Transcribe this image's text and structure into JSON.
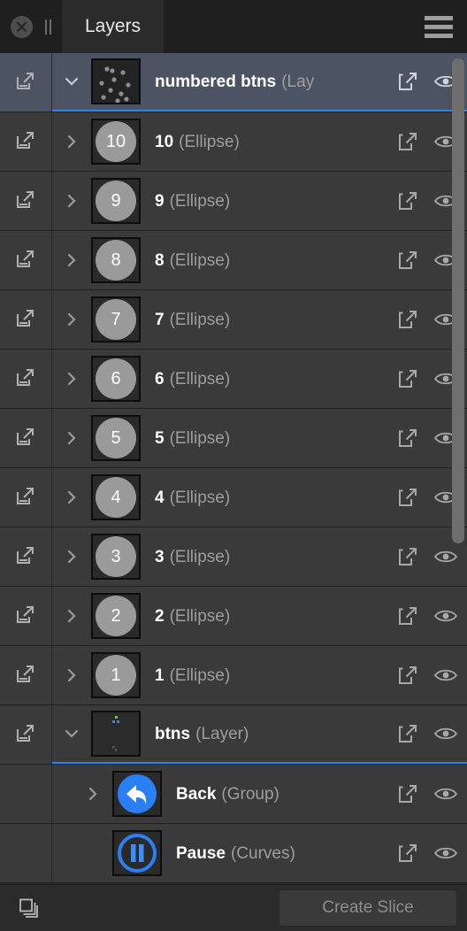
{
  "titlebar": {
    "close_icon": "close-circle-icon",
    "pause_icon": "pause-bars-icon",
    "tab_label": "Layers",
    "menu_icon": "hamburger-menu-icon"
  },
  "colors": {
    "accent_blue": "#2b88f0",
    "selected_row": "#4c5463",
    "row_bg": "#3a3a3a",
    "panel_bg": "#2e2e2e",
    "titlebar_bg": "#1f1f1f",
    "circle_gray": "#9a9a9a",
    "text_primary": "#ffffff",
    "text_secondary": "#9e9e9e"
  },
  "layers": [
    {
      "name": "numbered btns",
      "type": "(Lay",
      "type_full": "(Layer)",
      "thumb": "dots",
      "selected": true,
      "expanded": true,
      "has_export_cell": true,
      "truncated": true,
      "disclosure": "chevron-down-icon",
      "indent": 0
    },
    {
      "name": "10",
      "type": "(Ellipse)",
      "thumb": "number",
      "thumb_value": "10",
      "selected": false,
      "expanded": false,
      "has_export_cell": true,
      "truncated": false,
      "disclosure": "chevron-right-icon",
      "indent": 0
    },
    {
      "name": "9",
      "type": "(Ellipse)",
      "thumb": "number",
      "thumb_value": "9",
      "selected": false,
      "expanded": false,
      "has_export_cell": true,
      "truncated": false,
      "disclosure": "chevron-right-icon",
      "indent": 0
    },
    {
      "name": "8",
      "type": "(Ellipse)",
      "thumb": "number",
      "thumb_value": "8",
      "selected": false,
      "expanded": false,
      "has_export_cell": true,
      "truncated": false,
      "disclosure": "chevron-right-icon",
      "indent": 0
    },
    {
      "name": "7",
      "type": "(Ellipse)",
      "thumb": "number",
      "thumb_value": "7",
      "selected": false,
      "expanded": false,
      "has_export_cell": true,
      "truncated": false,
      "disclosure": "chevron-right-icon",
      "indent": 0
    },
    {
      "name": "6",
      "type": "(Ellipse)",
      "thumb": "number",
      "thumb_value": "6",
      "selected": false,
      "expanded": false,
      "has_export_cell": true,
      "truncated": false,
      "disclosure": "chevron-right-icon",
      "indent": 0
    },
    {
      "name": "5",
      "type": "(Ellipse)",
      "thumb": "number",
      "thumb_value": "5",
      "selected": false,
      "expanded": false,
      "has_export_cell": true,
      "truncated": false,
      "disclosure": "chevron-right-icon",
      "indent": 0
    },
    {
      "name": "4",
      "type": "(Ellipse)",
      "thumb": "number",
      "thumb_value": "4",
      "selected": false,
      "expanded": false,
      "has_export_cell": true,
      "truncated": false,
      "disclosure": "chevron-right-icon",
      "indent": 0
    },
    {
      "name": "3",
      "type": "(Ellipse)",
      "thumb": "number",
      "thumb_value": "3",
      "selected": false,
      "expanded": false,
      "has_export_cell": true,
      "truncated": false,
      "disclosure": "chevron-right-icon",
      "indent": 0
    },
    {
      "name": "2",
      "type": "(Ellipse)",
      "thumb": "number",
      "thumb_value": "2",
      "selected": false,
      "expanded": false,
      "has_export_cell": true,
      "truncated": false,
      "disclosure": "chevron-right-icon",
      "indent": 0
    },
    {
      "name": "1",
      "type": "(Ellipse)",
      "thumb": "number",
      "thumb_value": "1",
      "selected": false,
      "expanded": false,
      "has_export_cell": true,
      "truncated": false,
      "disclosure": "chevron-right-icon",
      "indent": 0
    },
    {
      "name": "btns",
      "type": "(Layer)",
      "thumb": "btns",
      "selected": false,
      "expanded": true,
      "has_export_cell": true,
      "truncated": false,
      "underline": true,
      "disclosure": "chevron-down-icon",
      "indent": 0
    },
    {
      "name": "Back",
      "type": "(Group)",
      "thumb": "back",
      "selected": false,
      "expanded": false,
      "has_export_cell": false,
      "truncated": false,
      "disclosure": "chevron-right-icon",
      "indent": 1
    },
    {
      "name": "Pause",
      "type": "(Curves)",
      "thumb": "pause",
      "selected": false,
      "expanded": false,
      "has_export_cell": false,
      "truncated": false,
      "disclosure": "none",
      "indent": 1
    }
  ],
  "row_icons": {
    "export": "export-external-icon",
    "visibility": "eye-visibility-icon",
    "left_export": "export-external-icon"
  },
  "bottombar": {
    "stack_icon": "duplicate-layers-icon",
    "create_slice_label": "Create Slice"
  },
  "scrollbar": {
    "name": "vertical-scrollbar"
  }
}
